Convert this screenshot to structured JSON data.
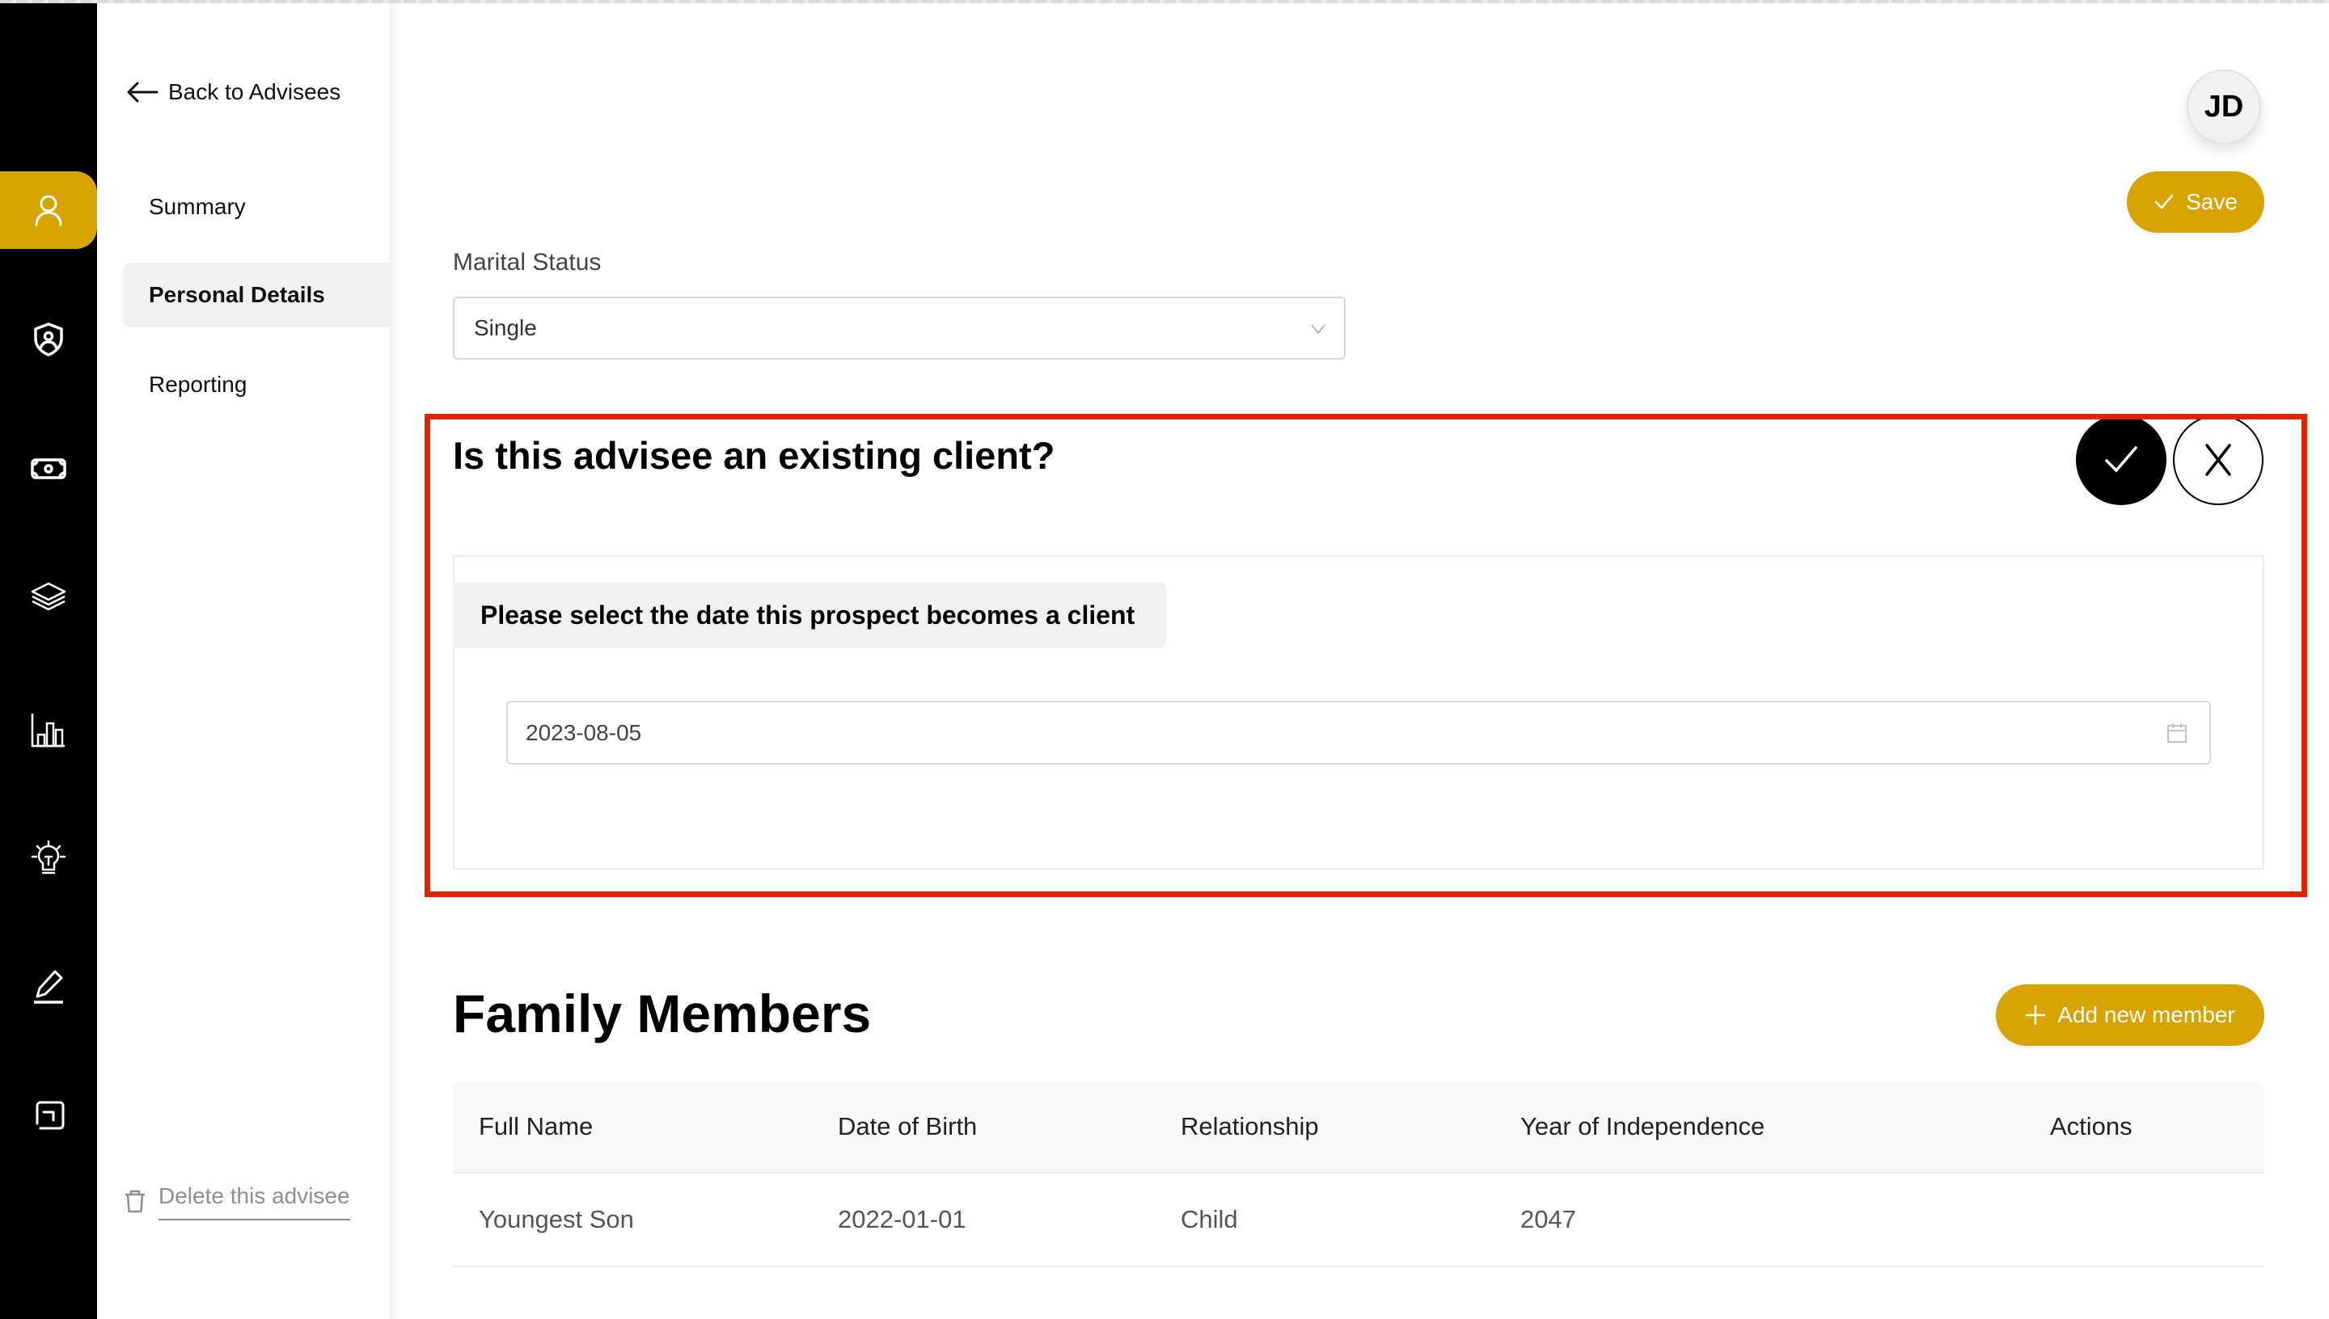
{
  "rail": {
    "items": [
      {
        "icon": "person-icon",
        "active": true
      },
      {
        "icon": "shield-user-icon",
        "active": false
      },
      {
        "icon": "money-icon",
        "active": false
      },
      {
        "icon": "layers-icon",
        "active": false
      },
      {
        "icon": "bar-chart-icon",
        "active": false
      },
      {
        "icon": "lightbulb-icon",
        "active": false
      },
      {
        "icon": "pen-icon",
        "active": false
      },
      {
        "icon": "exit-icon",
        "active": false
      }
    ],
    "accent_color": "#d6a300"
  },
  "subnav": {
    "back_label": "Back to Advisees",
    "items": [
      {
        "label": "Summary",
        "active": false
      },
      {
        "label": "Personal Details",
        "active": true
      },
      {
        "label": "Reporting",
        "active": false
      }
    ],
    "delete_label": "Delete this advisee"
  },
  "header": {
    "avatar_initials": "JD",
    "save_label": "Save"
  },
  "marital_status": {
    "label": "Marital Status",
    "value": "Single"
  },
  "existing_client": {
    "question": "Is this advisee an existing client?",
    "yes_icon": "check-icon",
    "no_icon": "x-icon",
    "selected": "yes",
    "date_prompt": "Please select the date this prospect becomes a client",
    "date_value": "2023-08-05"
  },
  "family_members": {
    "title": "Family Members",
    "add_label": "Add new member",
    "columns": [
      "Full Name",
      "Date of Birth",
      "Relationship",
      "Year of Independence",
      "Actions"
    ],
    "rows": [
      {
        "full_name": "Youngest Son",
        "date_of_birth": "2022-01-01",
        "relationship": "Child",
        "year_of_independence": "2047",
        "actions": ""
      }
    ]
  },
  "annotation": {
    "color": "#e02300"
  }
}
